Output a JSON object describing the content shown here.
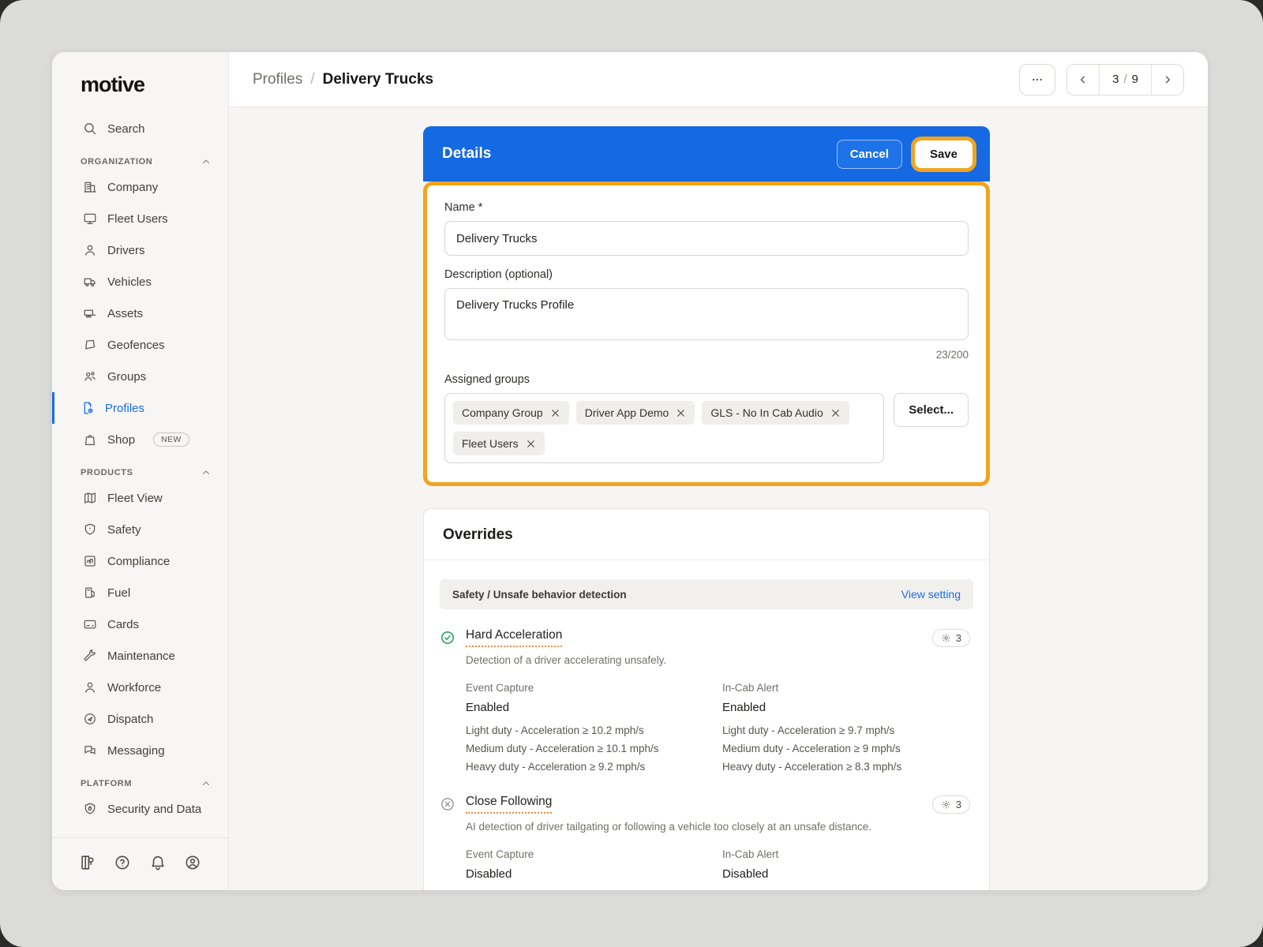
{
  "colors": {
    "accent_blue": "#1569E2",
    "highlight_amber": "#F0A41E",
    "link_blue": "#1A6EE8",
    "status_green": "#1E9E5A",
    "sidebar_bg": "#F7F6F4"
  },
  "sidebar": {
    "logo": "motive",
    "search_label": "Search",
    "org_label": "ORGANIZATION",
    "org_items": [
      "Company",
      "Fleet Users",
      "Drivers",
      "Vehicles",
      "Assets",
      "Geofences",
      "Groups",
      "Profiles",
      "Shop"
    ],
    "shop_badge": "NEW",
    "products_label": "PRODUCTS",
    "product_items": [
      "Fleet View",
      "Safety",
      "Compliance",
      "Fuel",
      "Cards",
      "Maintenance",
      "Workforce",
      "Dispatch",
      "Messaging"
    ],
    "platform_label": "PLATFORM",
    "platform_items": [
      "Security and Data"
    ],
    "footer_icons": [
      "resources",
      "help",
      "notifications",
      "account"
    ]
  },
  "header": {
    "breadcrumb_parent": "Profiles",
    "breadcrumb_separator": "/",
    "breadcrumb_current": "Delivery Trucks",
    "more_label": "...",
    "pagination": {
      "current": "3",
      "separator": "/",
      "total": "9"
    }
  },
  "details": {
    "title": "Details",
    "cancel_label": "Cancel",
    "save_label": "Save",
    "name_label": "Name *",
    "name_value": "Delivery Trucks",
    "description_label": "Description (optional)",
    "description_value": "Delivery Trucks Profile",
    "char_counter": "23/200",
    "assigned_groups_label": "Assigned groups",
    "groups": [
      "Company Group",
      "Driver App Demo",
      "GLS - No In Cab Audio",
      "Fleet Users"
    ],
    "select_label": "Select..."
  },
  "overrides": {
    "title": "Overrides",
    "section_header": "Safety / Unsafe behavior detection",
    "view_setting_label": "View setting",
    "settings": [
      {
        "name": "Hard Acceleration",
        "status": "enabled",
        "badge_count": "3",
        "description": "Detection of a driver accelerating unsafely.",
        "columns": [
          {
            "label": "Event Capture",
            "state": "Enabled",
            "lines": [
              "Light duty - Acceleration ≥ 10.2 mph/s",
              "Medium duty - Acceleration ≥ 10.1 mph/s",
              "Heavy duty - Acceleration ≥ 9.2 mph/s"
            ]
          },
          {
            "label": "In-Cab Alert",
            "state": "Enabled",
            "lines": [
              "Light duty - Acceleration ≥ 9.7 mph/s",
              "Medium duty - Acceleration ≥ 9 mph/s",
              "Heavy duty - Acceleration ≥ 8.3 mph/s"
            ]
          }
        ]
      },
      {
        "name": "Close Following",
        "status": "disabled",
        "badge_count": "3",
        "description": "AI detection of driver tailgating or following a vehicle too closely at an unsafe distance.",
        "columns": [
          {
            "label": "Event Capture",
            "state": "Disabled",
            "lines": []
          },
          {
            "label": "In-Cab Alert",
            "state": "Disabled",
            "lines": []
          }
        ]
      }
    ]
  }
}
